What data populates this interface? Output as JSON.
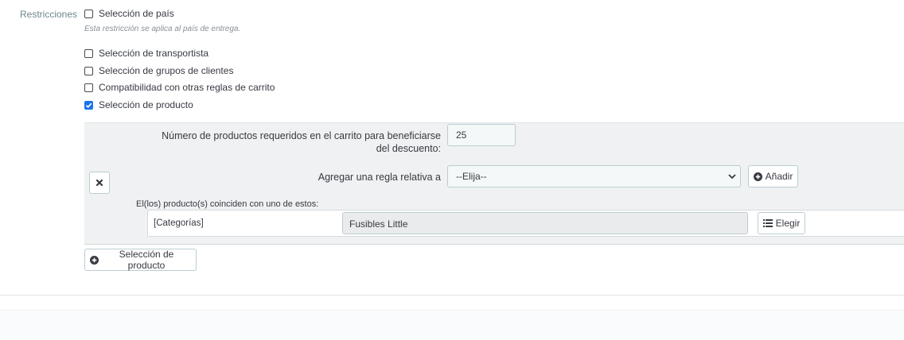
{
  "restrictions": {
    "label": "Restricciones",
    "country": {
      "label": "Selección de país",
      "checked": false
    },
    "country_help": "Esta restricción se aplica al país de entrega.",
    "carrier": {
      "label": "Selección de transportista",
      "checked": false
    },
    "customer_groups": {
      "label": "Selección de grupos de clientes",
      "checked": false
    },
    "compatibility": {
      "label": "Compatibilidad con otras reglas de carrito",
      "checked": false
    },
    "product": {
      "label": "Selección de producto",
      "checked": true
    }
  },
  "product_rule": {
    "quantity_label_line1": "Número de productos requeridos en el carrito para beneficiarse",
    "quantity_label_line2": "del descuento:",
    "quantity_value": "25",
    "add_rule_label": "Agregar una regla relativa a",
    "add_rule_select_value": "--Elija--",
    "add_button_label": "Añadir",
    "match_label": "El(los) producto(s) coinciden con uno de estos:",
    "rule_type": "[Categorías]",
    "rule_value": "Fusibles Little",
    "choose_button_label": "Elegir"
  },
  "add_product_selection_label": "Selección de producto",
  "icons": {
    "remove": "close-icon",
    "add": "plus-circle-icon",
    "list": "list-icon",
    "select": "chevron-down-icon",
    "checkbox": "check-icon"
  },
  "colors": {
    "accent": "#1a73e8",
    "panel": "#eff1f2"
  }
}
